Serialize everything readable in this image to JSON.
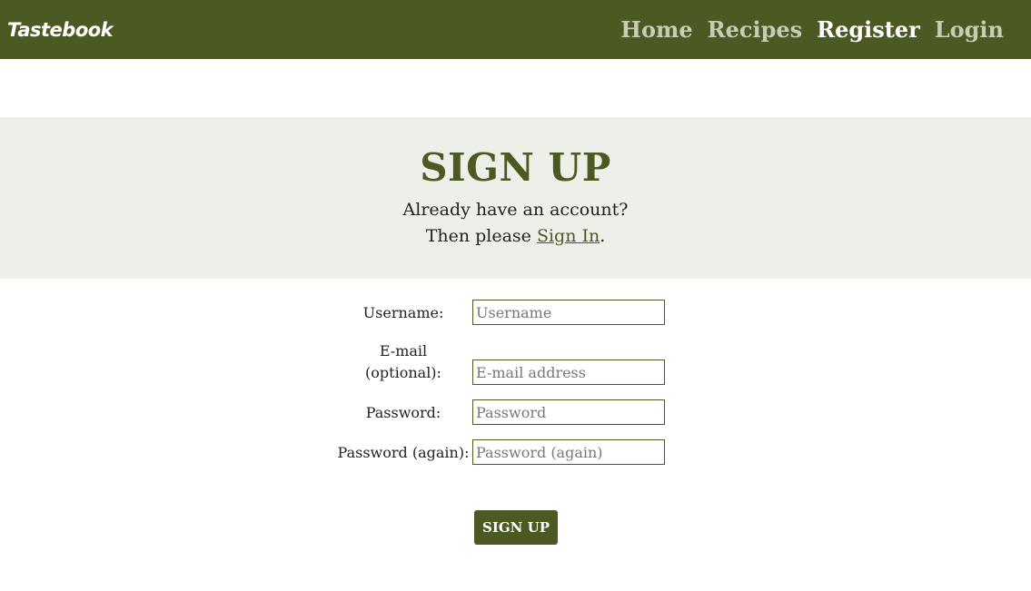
{
  "brand": "Tastebook",
  "nav": {
    "home": "Home",
    "recipes": "Recipes",
    "register": "Register",
    "login": "Login"
  },
  "hero": {
    "title": "SIGN UP",
    "line1": "Already have an account?",
    "line2_prefix": "Then please ",
    "signin_link": "Sign In",
    "line2_suffix": "."
  },
  "form": {
    "username_label": "Username:",
    "username_placeholder": "Username",
    "email_label_line1": "E-mail",
    "email_label_line2": "(optional):",
    "email_placeholder": "E-mail address",
    "password_label": "Password:",
    "password_placeholder": "Password",
    "password2_label": "Password (again):",
    "password2_placeholder": "Password (again)",
    "submit_label": "SIGN UP"
  },
  "colors": {
    "brand": "#4b5a23",
    "hero_bg": "#eeefe9",
    "nav_inactive": "#c7ccb6"
  }
}
